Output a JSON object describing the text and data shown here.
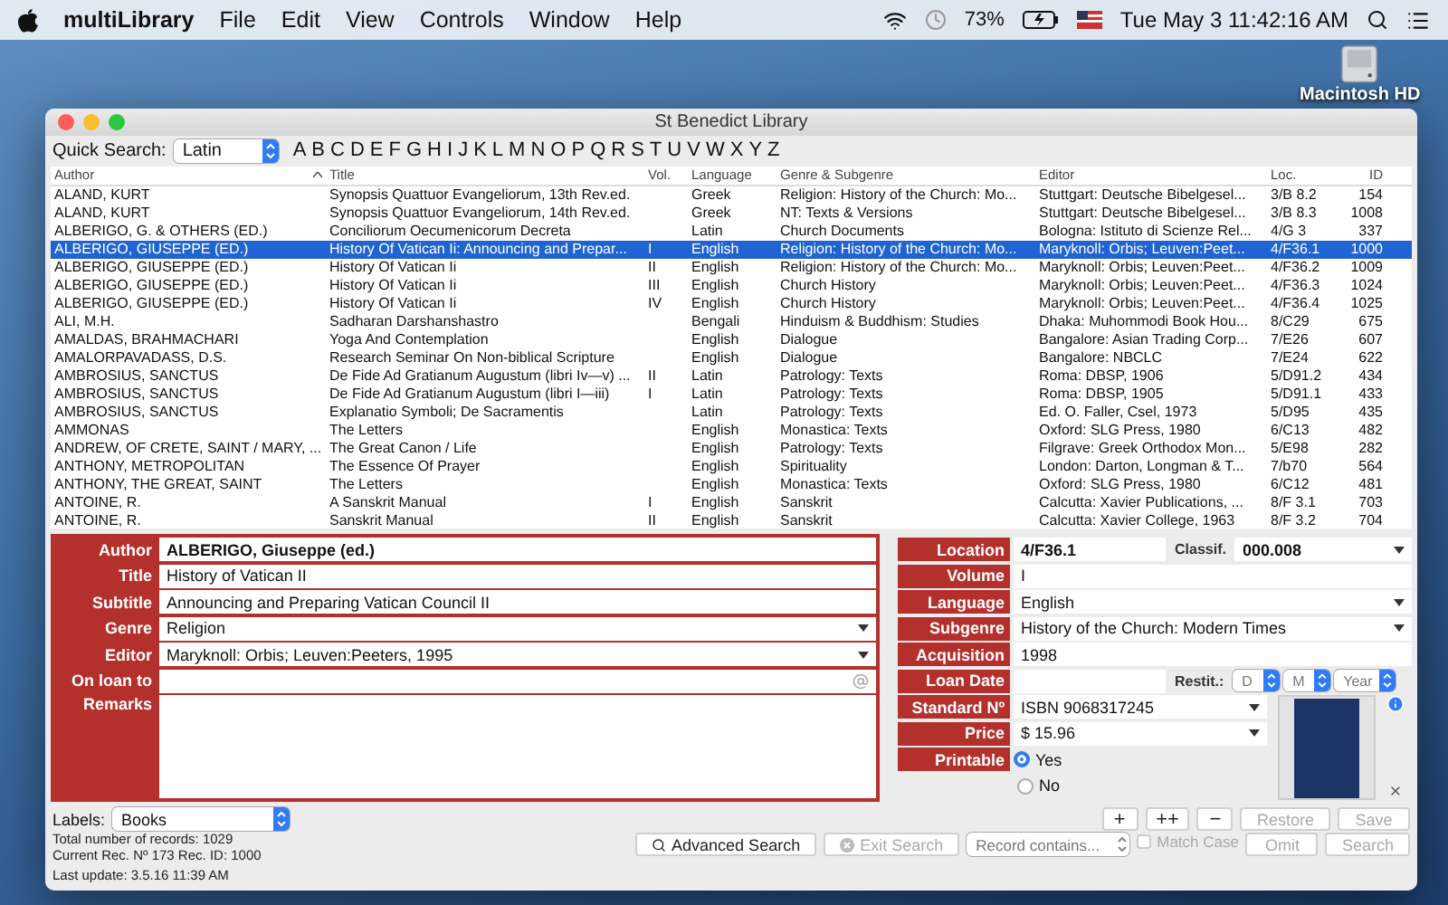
{
  "menubar": {
    "app_name": "multiLibrary",
    "menus": [
      "File",
      "Edit",
      "View",
      "Controls",
      "Window",
      "Help"
    ],
    "battery": "73%",
    "clock": "Tue May 3  11:42:16 AM"
  },
  "desktop_icon": {
    "label": "Macintosh HD"
  },
  "window": {
    "title": "St Benedict Library"
  },
  "quick_search": {
    "label": "Quick Search:",
    "value": "Latin",
    "letters": [
      "A",
      "B",
      "C",
      "D",
      "E",
      "F",
      "G",
      "H",
      "I",
      "J",
      "K",
      "L",
      "M",
      "N",
      "O",
      "P",
      "Q",
      "R",
      "S",
      "T",
      "U",
      "V",
      "W",
      "X",
      "Y",
      "Z"
    ]
  },
  "table": {
    "columns": [
      "Author",
      "Title",
      "Vol.",
      "Language",
      "Genre & Subgenre",
      "Editor",
      "Loc.",
      "ID"
    ],
    "rows": [
      {
        "selected": false,
        "cells": [
          "ALAND, KURT",
          "Synopsis Quattuor Evangeliorum, 13th Rev.ed.",
          "",
          "Greek",
          "Religion: History of the Church: Mo...",
          "Stuttgart: Deutsche Bibelgesel...",
          "3/B 8.2",
          "154"
        ]
      },
      {
        "selected": false,
        "cells": [
          "ALAND, KURT",
          "Synopsis Quattuor Evangeliorum, 14th Rev.ed.",
          "",
          "Greek",
          "NT: Texts & Versions",
          "Stuttgart: Deutsche Bibelgesel...",
          "3/B 8.3",
          "1008"
        ]
      },
      {
        "selected": false,
        "cells": [
          "ALBERIGO, G. & OTHERS (ED.)",
          "Conciliorum Oecumenicorum Decreta",
          "",
          "Latin",
          "Church Documents",
          "Bologna: Istituto di Scienze Rel...",
          "4/G 3",
          "337"
        ]
      },
      {
        "selected": true,
        "cells": [
          "ALBERIGO, GIUSEPPE (ED.)",
          "History Of Vatican Ii: Announcing and Prepar...",
          "I",
          "English",
          "Religion: History of the Church: Mo...",
          "Maryknoll: Orbis; Leuven:Peet...",
          "4/F36.1",
          "1000"
        ]
      },
      {
        "selected": false,
        "cells": [
          "ALBERIGO, GIUSEPPE (ED.)",
          "History Of Vatican Ii",
          "II",
          "English",
          "Religion: History of the Church: Mo...",
          "Maryknoll: Orbis; Leuven:Peet...",
          "4/F36.2",
          "1009"
        ]
      },
      {
        "selected": false,
        "cells": [
          "ALBERIGO, GIUSEPPE (ED.)",
          "History Of Vatican Ii",
          "III",
          "English",
          "Church History",
          "Maryknoll: Orbis; Leuven:Peet...",
          "4/F36.3",
          "1024"
        ]
      },
      {
        "selected": false,
        "cells": [
          "ALBERIGO, GIUSEPPE (ED.)",
          "History Of Vatican Ii",
          "IV",
          "English",
          "Church History",
          "Maryknoll: Orbis; Leuven:Peet...",
          "4/F36.4",
          "1025"
        ]
      },
      {
        "selected": false,
        "cells": [
          "ALI, M.H.",
          "Sadharan Darshanshastro",
          "",
          "Bengali",
          "Hinduism & Buddhism: Studies",
          "Dhaka: Muhommodi Book Hou...",
          "8/C29",
          "675"
        ]
      },
      {
        "selected": false,
        "cells": [
          "AMALDAS, BRAHMACHARI",
          "Yoga And Contemplation",
          "",
          "English",
          "Dialogue",
          "Bangalore: Asian Trading Corp...",
          "7/E26",
          "607"
        ]
      },
      {
        "selected": false,
        "cells": [
          "AMALORPAVADASS, D.S.",
          "Research Seminar On Non-biblical Scripture",
          "",
          "English",
          "Dialogue",
          "Bangalore: NBCLC",
          "7/E24",
          "622"
        ]
      },
      {
        "selected": false,
        "cells": [
          "AMBROSIUS, SANCTUS",
          "De Fide Ad Gratianum Augustum (libri Iv—v) ...",
          "II",
          "Latin",
          "Patrology: Texts",
          "Roma: DBSP, 1906",
          "5/D91.2",
          "434"
        ]
      },
      {
        "selected": false,
        "cells": [
          "AMBROSIUS, SANCTUS",
          "De Fide Ad Gratianum Augustum (libri I—iii)",
          "I",
          "Latin",
          "Patrology: Texts",
          "Roma: DBSP, 1905",
          "5/D91.1",
          "433"
        ]
      },
      {
        "selected": false,
        "cells": [
          "AMBROSIUS, SANCTUS",
          "Explanatio Symboli; De Sacramentis",
          "",
          "Latin",
          "Patrology: Texts",
          "Ed. O. Faller, Csel, 1973",
          "5/D95",
          "435"
        ]
      },
      {
        "selected": false,
        "cells": [
          "AMMONAS",
          "The Letters",
          "",
          "English",
          "Monastica: Texts",
          "Oxford: SLG Press, 1980",
          "6/C13",
          "482"
        ]
      },
      {
        "selected": false,
        "cells": [
          "ANDREW, OF CRETE, SAINT / MARY, ...",
          "The Great Canon / Life",
          "",
          "English",
          "Patrology: Texts",
          "Filgrave: Greek Orthodox Mon...",
          "5/E98",
          "282"
        ]
      },
      {
        "selected": false,
        "cells": [
          "ANTHONY, METROPOLITAN",
          "The Essence Of Prayer",
          "",
          "English",
          "Spirituality",
          "London: Darton, Longman & T...",
          "7/b70",
          "564"
        ]
      },
      {
        "selected": false,
        "cells": [
          "ANTHONY, THE GREAT, SAINT",
          "The Letters",
          "",
          "English",
          "Monastica: Texts",
          "Oxford: SLG Press, 1980",
          "6/C12",
          "481"
        ]
      },
      {
        "selected": false,
        "cells": [
          "ANTOINE, R.",
          "A Sanskrit Manual",
          "I",
          "English",
          "Sanskrit",
          "Calcutta: Xavier Publications, ...",
          "8/F 3.1",
          "703"
        ]
      },
      {
        "selected": false,
        "cells": [
          "ANTOINE, R.",
          "Sanskrit Manual",
          "II",
          "English",
          "Sanskrit",
          "Calcutta: Xavier College, 1963",
          "8/F 3.2",
          "704"
        ]
      }
    ]
  },
  "form_left": {
    "fields": [
      {
        "label": "Author",
        "value": "ALBERIGO, Giuseppe (ed.)",
        "kind": "bold"
      },
      {
        "label": "Title",
        "value": "History of Vatican II",
        "kind": "text"
      },
      {
        "label": "Subtitle",
        "value": "Announcing and Preparing Vatican Council II",
        "kind": "text"
      },
      {
        "label": "Genre",
        "value": "Religion",
        "kind": "dropdown"
      },
      {
        "label": "Editor",
        "value": "Maryknoll: Orbis; Leuven:Peeters, 1995",
        "kind": "dropdown"
      },
      {
        "label": "On loan to",
        "kind": "email"
      }
    ],
    "remarks_label": "Remarks"
  },
  "form_right": {
    "fields": [
      {
        "label": "Location",
        "value": "4/F36.1",
        "kind": "location",
        "extra_label": "Classif.",
        "extra_value": "000.008"
      },
      {
        "label": "Volume",
        "value": "I",
        "kind": "text"
      },
      {
        "label": "Language",
        "value": "English",
        "kind": "dropdown"
      },
      {
        "label": "Subgenre",
        "value": "History of the Church: Modern Times",
        "kind": "dropdown"
      },
      {
        "label": "Acquisition",
        "value": "1998",
        "kind": "text"
      },
      {
        "label": "Loan Date",
        "kind": "loan",
        "extra_label": "Restit.:",
        "selects": [
          "D",
          "M",
          "Year"
        ]
      }
    ],
    "lower_fields": [
      {
        "label": "Standard Nº",
        "value": "ISBN 9068317245"
      },
      {
        "label": "Price",
        "value": "$ 15.96"
      }
    ],
    "printable": {
      "label": "Printable",
      "options": [
        {
          "label": "Yes",
          "selected": true
        },
        {
          "label": "No",
          "selected": false
        }
      ]
    }
  },
  "labels": {
    "label": "Labels:",
    "value": "Books"
  },
  "record_buttons": [
    {
      "label": "+",
      "disabled": false
    },
    {
      "label": "++",
      "disabled": false
    },
    {
      "label": "−",
      "disabled": false
    },
    {
      "label": "Restore",
      "disabled": true
    },
    {
      "label": "Save",
      "disabled": true
    }
  ],
  "search_bar": {
    "advanced": {
      "label": "Advanced Search",
      "disabled": false
    },
    "exit": {
      "label": "Exit Search",
      "disabled": true
    },
    "record_filter": "Record contains...",
    "match_case": {
      "label": "Match Case",
      "checked": false,
      "disabled": true
    },
    "buttons": [
      {
        "label": "Omit",
        "disabled": true
      },
      {
        "label": "Search",
        "disabled": true
      }
    ]
  },
  "status": {
    "total": "Total number of records: 1029",
    "current": "Current Rec. Nº 173   Rec. ID: 1000",
    "last_update": "Last update: 3.5.16  11:39 AM"
  }
}
